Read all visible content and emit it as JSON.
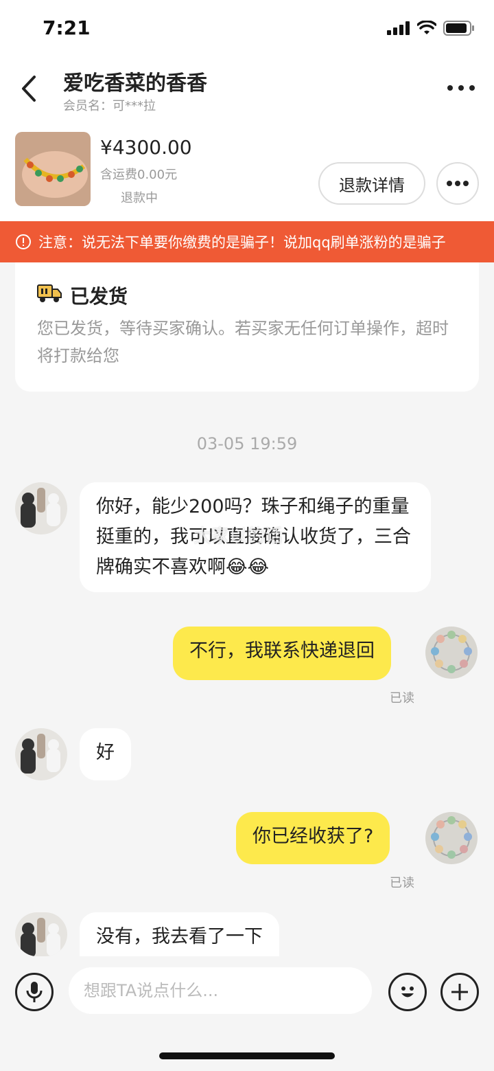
{
  "status_bar": {
    "time": "7:21"
  },
  "header": {
    "shop_name": "爱吃香菜的香香",
    "member_label": "会员名：",
    "member_name": "可***拉"
  },
  "product": {
    "price": "¥4300.00",
    "shipping": "含运费0.00元",
    "status": "退款中",
    "refund_button": "退款详情"
  },
  "warning": {
    "text": "注意：说无法下单要你缴费的是骗子！说加qq刷单涨粉的是骗子"
  },
  "shipped_card": {
    "title": "已发货",
    "description": "您已发货，等待买家确认。若买家无任何订单操作，超时将打款给您"
  },
  "chat": {
    "timestamp": "03-05 19:59",
    "messages": [
      {
        "side": "in",
        "text": "你好，能少200吗？珠子和绳子的重量挺重的，我可以直接确认收货了，三合牌确实不喜欢啊😂😂"
      },
      {
        "side": "out",
        "text": "不行，我联系快递退回",
        "read": "已读"
      },
      {
        "side": "in",
        "text": "好"
      },
      {
        "side": "out",
        "text": "你已经收获了?",
        "read": "已读"
      },
      {
        "side": "in",
        "text": "没有，我去看了一下"
      }
    ],
    "watermark": "大家以的话"
  },
  "input_bar": {
    "placeholder": "想跟TA说点什么..."
  },
  "colors": {
    "accent_yellow": "#fde94c",
    "warning_orange": "#ef5a35"
  },
  "icons": [
    "back-arrow-icon",
    "more-icon",
    "warning-icon",
    "truck-icon",
    "voice-icon",
    "emoji-icon",
    "plus-icon"
  ]
}
